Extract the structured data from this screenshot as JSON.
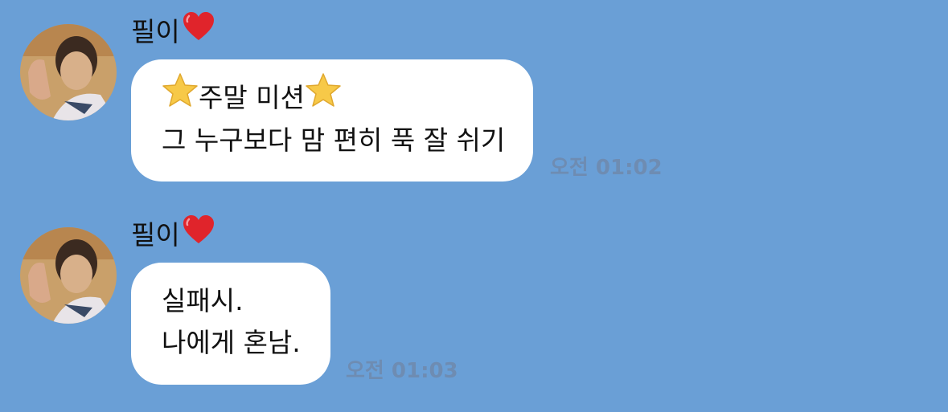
{
  "chat": {
    "messages": [
      {
        "sender": "필이",
        "sender_icon": "heart-icon",
        "lines": [
          {
            "star_left": "star-icon",
            "text": "주말 미션",
            "star_right": "star-icon"
          },
          {
            "text": "그 누구보다 맘 편히 푹 잘 쉬기"
          }
        ],
        "time": "오전 01:02"
      },
      {
        "sender": "필이",
        "sender_icon": "heart-icon",
        "lines": [
          {
            "text": "실패시."
          },
          {
            "text": "나에게 혼남."
          }
        ],
        "time": "오전 01:03"
      }
    ]
  },
  "colors": {
    "background": "#6a9fd6",
    "bubble": "#ffffff",
    "timestamp": "#6e8cb2",
    "heart": "#e0242b",
    "star": "#f7c948"
  }
}
